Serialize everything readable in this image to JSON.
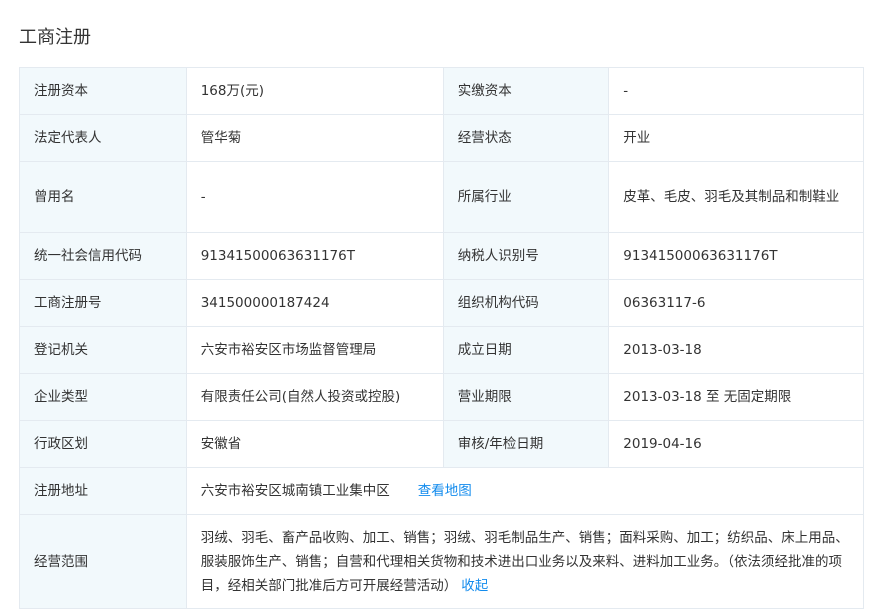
{
  "section": {
    "title": "工商注册"
  },
  "rows": {
    "registered_capital": {
      "label": "注册资本",
      "value": "168万(元)"
    },
    "paid_capital": {
      "label": "实缴资本",
      "value": "-"
    },
    "legal_rep": {
      "label": "法定代表人",
      "value": "管华菊"
    },
    "status": {
      "label": "经营状态",
      "value": "开业"
    },
    "former_name": {
      "label": "曾用名",
      "value": "-"
    },
    "industry": {
      "label": "所属行业",
      "value": "皮革、毛皮、羽毛及其制品和制鞋业"
    },
    "credit_code": {
      "label": "统一社会信用代码",
      "value": "91341500063631176T"
    },
    "taxpayer_id": {
      "label": "纳税人识别号",
      "value": "91341500063631176T"
    },
    "reg_number": {
      "label": "工商注册号",
      "value": "341500000187424"
    },
    "org_code": {
      "label": "组织机构代码",
      "value": "06363117-6"
    },
    "reg_authority": {
      "label": "登记机关",
      "value": "六安市裕安区市场监督管理局"
    },
    "established": {
      "label": "成立日期",
      "value": "2013-03-18"
    },
    "company_type": {
      "label": "企业类型",
      "value": "有限责任公司(自然人投资或控股)"
    },
    "business_term": {
      "label": "营业期限",
      "value": "2013-03-18 至 无固定期限"
    },
    "admin_region": {
      "label": "行政区划",
      "value": "安徽省"
    },
    "review_date": {
      "label": "审核/年检日期",
      "value": "2019-04-16"
    },
    "address": {
      "label": "注册地址",
      "value": "六安市裕安区城南镇工业集中区",
      "map_link": "查看地图"
    },
    "scope": {
      "label": "经营范围",
      "value": "羽绒、羽毛、畜产品收购、加工、销售；羽绒、羽毛制品生产、销售；面料采购、加工；纺织品、床上用品、服装服饰生产、销售；自营和代理相关货物和技术进出口业务以及来料、进料加工业务。（依法须经批准的项目，经相关部门批准后方可开展经营活动）",
      "collapse_link": "收起"
    }
  }
}
